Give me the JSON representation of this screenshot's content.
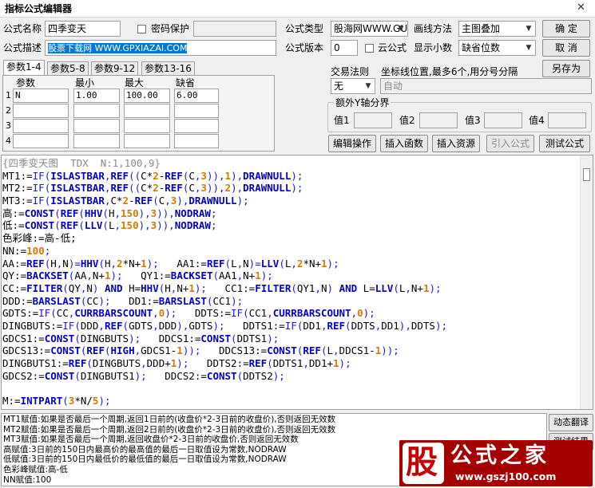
{
  "window": {
    "title": "指标公式编辑器",
    "close_glyph": "✕"
  },
  "form": {
    "name_label": "公式名称",
    "name_value": "四季变天",
    "password_label": "密码保护",
    "desc_label": "公式描述",
    "desc_value": "股票下载网 WWW.GPXIAZAI.COM",
    "type_label": "公式类型",
    "type_value": "股海网WWW.GU",
    "draw_label": "画线方法",
    "draw_value": "主图叠加",
    "version_label": "公式版本",
    "version_value": "0",
    "cloud_label": "云公式",
    "decimals_label": "显示小数",
    "decimals_value": "缺省位数",
    "trade_label": "交易法则",
    "trade_value": "无",
    "coord_label": "坐标线位置,最多6个,用分号分隔",
    "coord_value": "自动",
    "extra_axis_label": "额外Y轴分界",
    "extra_values": [
      {
        "label": "值1"
      },
      {
        "label": "值2"
      },
      {
        "label": "值3"
      },
      {
        "label": "值4"
      }
    ]
  },
  "buttons": {
    "ok": "确  定",
    "cancel": "取  消",
    "saveas": "另存为",
    "edit_ops": "编辑操作",
    "insert_fn": "插入函数",
    "insert_res": "插入资源",
    "import_formula": "引入公式",
    "test_formula": "测试公式"
  },
  "param_tabs": [
    "参数1-4",
    "参数5-8",
    "参数9-12",
    "参数13-16"
  ],
  "param_table": {
    "headers": [
      "参数",
      "最小",
      "最大",
      "缺省"
    ],
    "rows": [
      {
        "idx": "1",
        "name": "N",
        "min": "1.00",
        "max": "100.00",
        "def": "6.00"
      },
      {
        "idx": "2",
        "name": "",
        "min": "",
        "max": "",
        "def": ""
      },
      {
        "idx": "3",
        "name": "",
        "min": "",
        "max": "",
        "def": ""
      },
      {
        "idx": "4",
        "name": "",
        "min": "",
        "max": "",
        "def": ""
      }
    ]
  },
  "code_lines": [
    [
      [
        "cmt",
        "{四季变天图  TDX  N:1,100,9}"
      ]
    ],
    [
      [
        "var",
        "MT1:="
      ],
      [
        "kw",
        "IF("
      ],
      [
        "fn",
        "ISLASTBAR"
      ],
      [
        "kw",
        ","
      ],
      [
        "fn",
        "REF"
      ],
      [
        "kw",
        "(("
      ],
      [
        "var",
        "C*"
      ],
      [
        "num",
        "2"
      ],
      [
        "var",
        "-"
      ],
      [
        "fn",
        "REF"
      ],
      [
        "kw",
        "("
      ],
      [
        "var",
        "C"
      ],
      [
        "kw",
        ","
      ],
      [
        "num",
        "3"
      ],
      [
        "kw",
        "))"
      ],
      [
        "kw",
        ","
      ],
      [
        "num",
        "1"
      ],
      [
        "kw",
        "),"
      ],
      [
        "fn",
        "DRAWNULL"
      ],
      [
        "kw",
        ");"
      ]
    ],
    [
      [
        "var",
        "MT2:="
      ],
      [
        "kw",
        "IF("
      ],
      [
        "fn",
        "ISLASTBAR"
      ],
      [
        "kw",
        ","
      ],
      [
        "fn",
        "REF"
      ],
      [
        "kw",
        "(("
      ],
      [
        "var",
        "C*"
      ],
      [
        "num",
        "2"
      ],
      [
        "var",
        "-"
      ],
      [
        "fn",
        "REF"
      ],
      [
        "kw",
        "("
      ],
      [
        "var",
        "C"
      ],
      [
        "kw",
        ","
      ],
      [
        "num",
        "3"
      ],
      [
        "kw",
        "))"
      ],
      [
        "kw",
        ","
      ],
      [
        "num",
        "2"
      ],
      [
        "kw",
        "),"
      ],
      [
        "fn",
        "DRAWNULL"
      ],
      [
        "kw",
        ");"
      ]
    ],
    [
      [
        "var",
        "MT3:="
      ],
      [
        "kw",
        "IF("
      ],
      [
        "fn",
        "ISLASTBAR"
      ],
      [
        "kw",
        ","
      ],
      [
        "var",
        "C*"
      ],
      [
        "num",
        "2"
      ],
      [
        "var",
        "-"
      ],
      [
        "fn",
        "REF"
      ],
      [
        "kw",
        "("
      ],
      [
        "var",
        "C"
      ],
      [
        "kw",
        ","
      ],
      [
        "num",
        "3"
      ],
      [
        "kw",
        "),"
      ],
      [
        "fn",
        "DRAWNULL"
      ],
      [
        "kw",
        ");"
      ]
    ],
    [
      [
        "var",
        "高:="
      ],
      [
        "fn",
        "CONST"
      ],
      [
        "kw",
        "("
      ],
      [
        "fn",
        "REF"
      ],
      [
        "kw",
        "("
      ],
      [
        "fn",
        "HHV"
      ],
      [
        "kw",
        "("
      ],
      [
        "var",
        "H"
      ],
      [
        "kw",
        ","
      ],
      [
        "num",
        "150"
      ],
      [
        "kw",
        "),"
      ],
      [
        "num",
        "3"
      ],
      [
        "kw",
        "))"
      ],
      [
        "kw",
        ","
      ],
      [
        "fn",
        "NODRAW"
      ],
      [
        "kw",
        ";"
      ]
    ],
    [
      [
        "var",
        "低:="
      ],
      [
        "fn",
        "CONST"
      ],
      [
        "kw",
        "("
      ],
      [
        "fn",
        "REF"
      ],
      [
        "kw",
        "("
      ],
      [
        "fn",
        "LLV"
      ],
      [
        "kw",
        "("
      ],
      [
        "var",
        "L"
      ],
      [
        "kw",
        ","
      ],
      [
        "num",
        "150"
      ],
      [
        "kw",
        "),"
      ],
      [
        "num",
        "3"
      ],
      [
        "kw",
        "))"
      ],
      [
        "kw",
        ","
      ],
      [
        "fn",
        "NODRAW"
      ],
      [
        "kw",
        ";"
      ]
    ],
    [
      [
        "var",
        "色彩峰:=高-低;"
      ]
    ],
    [
      [
        "var",
        "NN:="
      ],
      [
        "num",
        "100"
      ],
      [
        "kw",
        ";"
      ]
    ],
    [
      [
        "var",
        "AA:="
      ],
      [
        "fn",
        "REF"
      ],
      [
        "kw",
        "("
      ],
      [
        "var",
        "H"
      ],
      [
        "kw",
        ","
      ],
      [
        "var",
        "N"
      ],
      [
        "kw",
        ")="
      ],
      [
        "fn",
        "HHV"
      ],
      [
        "kw",
        "("
      ],
      [
        "var",
        "H"
      ],
      [
        "kw",
        ","
      ],
      [
        "num",
        "2"
      ],
      [
        "var",
        "*N+"
      ],
      [
        "num",
        "1"
      ],
      [
        "kw",
        ");"
      ],
      [
        "var",
        "   AA1:="
      ],
      [
        "fn",
        "REF"
      ],
      [
        "kw",
        "("
      ],
      [
        "var",
        "L"
      ],
      [
        "kw",
        ","
      ],
      [
        "var",
        "N"
      ],
      [
        "kw",
        ")="
      ],
      [
        "fn",
        "LLV"
      ],
      [
        "kw",
        "("
      ],
      [
        "var",
        "L"
      ],
      [
        "kw",
        ","
      ],
      [
        "num",
        "2"
      ],
      [
        "var",
        "*N+"
      ],
      [
        "num",
        "1"
      ],
      [
        "kw",
        ");"
      ]
    ],
    [
      [
        "var",
        "QY:="
      ],
      [
        "fn",
        "BACKSET"
      ],
      [
        "kw",
        "("
      ],
      [
        "var",
        "AA"
      ],
      [
        "kw",
        ","
      ],
      [
        "var",
        "N+"
      ],
      [
        "num",
        "1"
      ],
      [
        "kw",
        ");"
      ],
      [
        "var",
        "   QY1:="
      ],
      [
        "fn",
        "BACKSET"
      ],
      [
        "kw",
        "("
      ],
      [
        "var",
        "AA1"
      ],
      [
        "kw",
        ","
      ],
      [
        "var",
        "N+"
      ],
      [
        "num",
        "1"
      ],
      [
        "kw",
        ");"
      ]
    ],
    [
      [
        "var",
        "CC:="
      ],
      [
        "fn",
        "FILTER"
      ],
      [
        "kw",
        "("
      ],
      [
        "var",
        "QY"
      ],
      [
        "kw",
        ","
      ],
      [
        "var",
        "N"
      ],
      [
        "kw",
        ") "
      ],
      [
        "fn",
        "AND"
      ],
      [
        "var",
        " H="
      ],
      [
        "fn",
        "HHV"
      ],
      [
        "kw",
        "("
      ],
      [
        "var",
        "H"
      ],
      [
        "kw",
        ","
      ],
      [
        "var",
        "N+"
      ],
      [
        "num",
        "1"
      ],
      [
        "kw",
        ");"
      ],
      [
        "var",
        "   CC1:="
      ],
      [
        "fn",
        "FILTER"
      ],
      [
        "kw",
        "("
      ],
      [
        "var",
        "QY1"
      ],
      [
        "kw",
        ","
      ],
      [
        "var",
        "N"
      ],
      [
        "kw",
        ") "
      ],
      [
        "fn",
        "AND"
      ],
      [
        "var",
        " L="
      ],
      [
        "fn",
        "LLV"
      ],
      [
        "kw",
        "("
      ],
      [
        "var",
        "L"
      ],
      [
        "kw",
        ","
      ],
      [
        "var",
        "N+"
      ],
      [
        "num",
        "1"
      ],
      [
        "kw",
        ");"
      ]
    ],
    [
      [
        "var",
        "DDD:="
      ],
      [
        "fn",
        "BARSLAST"
      ],
      [
        "kw",
        "("
      ],
      [
        "var",
        "CC"
      ],
      [
        "kw",
        ");"
      ],
      [
        "var",
        "   DD1:="
      ],
      [
        "fn",
        "BARSLAST"
      ],
      [
        "kw",
        "("
      ],
      [
        "var",
        "CC1"
      ],
      [
        "kw",
        ");"
      ]
    ],
    [
      [
        "var",
        "GDTS:="
      ],
      [
        "kw",
        "IF("
      ],
      [
        "var",
        "CC"
      ],
      [
        "kw",
        ","
      ],
      [
        "fn",
        "CURRBARSCOUNT"
      ],
      [
        "kw",
        ","
      ],
      [
        "num",
        "0"
      ],
      [
        "kw",
        ");"
      ],
      [
        "var",
        "   DDTS:="
      ],
      [
        "kw",
        "IF("
      ],
      [
        "var",
        "CC1"
      ],
      [
        "kw",
        ","
      ],
      [
        "fn",
        "CURRBARSCOUNT"
      ],
      [
        "kw",
        ","
      ],
      [
        "num",
        "0"
      ],
      [
        "kw",
        ");"
      ]
    ],
    [
      [
        "var",
        "DINGBUTS:="
      ],
      [
        "kw",
        "IF("
      ],
      [
        "var",
        "DDD"
      ],
      [
        "kw",
        ","
      ],
      [
        "fn",
        "REF"
      ],
      [
        "kw",
        "("
      ],
      [
        "var",
        "GDTS"
      ],
      [
        "kw",
        ","
      ],
      [
        "var",
        "DDD"
      ],
      [
        "kw",
        "),"
      ],
      [
        "var",
        "GDTS"
      ],
      [
        "kw",
        ");"
      ],
      [
        "var",
        "   DDTS1:="
      ],
      [
        "kw",
        "IF("
      ],
      [
        "var",
        "DD1"
      ],
      [
        "kw",
        ","
      ],
      [
        "fn",
        "REF"
      ],
      [
        "kw",
        "("
      ],
      [
        "var",
        "DDTS"
      ],
      [
        "kw",
        ","
      ],
      [
        "var",
        "DD1"
      ],
      [
        "kw",
        "),"
      ],
      [
        "var",
        "DDTS"
      ],
      [
        "kw",
        ");"
      ]
    ],
    [
      [
        "var",
        "GDCS1:="
      ],
      [
        "fn",
        "CONST"
      ],
      [
        "kw",
        "("
      ],
      [
        "var",
        "DINGBUTS"
      ],
      [
        "kw",
        ");"
      ],
      [
        "var",
        "   DDCS1:="
      ],
      [
        "fn",
        "CONST"
      ],
      [
        "kw",
        "("
      ],
      [
        "var",
        "DDTS1"
      ],
      [
        "kw",
        ");"
      ]
    ],
    [
      [
        "var",
        "GDCS13:="
      ],
      [
        "fn",
        "CONST"
      ],
      [
        "kw",
        "("
      ],
      [
        "fn",
        "REF"
      ],
      [
        "kw",
        "("
      ],
      [
        "fn",
        "HIGH"
      ],
      [
        "kw",
        ","
      ],
      [
        "var",
        "GDCS1-"
      ],
      [
        "num",
        "1"
      ],
      [
        "kw",
        "));"
      ],
      [
        "var",
        "   DDCS13:="
      ],
      [
        "fn",
        "CONST"
      ],
      [
        "kw",
        "("
      ],
      [
        "fn",
        "REF"
      ],
      [
        "kw",
        "("
      ],
      [
        "var",
        "L"
      ],
      [
        "kw",
        ","
      ],
      [
        "var",
        "DDCS1-"
      ],
      [
        "num",
        "1"
      ],
      [
        "kw",
        "));"
      ]
    ],
    [
      [
        "var",
        "DINGBUTS1:="
      ],
      [
        "fn",
        "REF"
      ],
      [
        "kw",
        "("
      ],
      [
        "var",
        "DINGBUTS"
      ],
      [
        "kw",
        ","
      ],
      [
        "var",
        "DDD+"
      ],
      [
        "num",
        "1"
      ],
      [
        "kw",
        ");"
      ],
      [
        "var",
        "   DDTS2:="
      ],
      [
        "fn",
        "REF"
      ],
      [
        "kw",
        "("
      ],
      [
        "var",
        "DDTS1"
      ],
      [
        "kw",
        ","
      ],
      [
        "var",
        "DD1+"
      ],
      [
        "num",
        "1"
      ],
      [
        "kw",
        ");"
      ]
    ],
    [
      [
        "var",
        "GDCS2:="
      ],
      [
        "fn",
        "CONST"
      ],
      [
        "kw",
        "("
      ],
      [
        "var",
        "DINGBUTS1"
      ],
      [
        "kw",
        ");"
      ],
      [
        "var",
        "   DDCS2:="
      ],
      [
        "fn",
        "CONST"
      ],
      [
        "kw",
        "("
      ],
      [
        "var",
        "DDTS2"
      ],
      [
        "kw",
        ");"
      ]
    ],
    [
      [
        "var",
        ""
      ]
    ],
    [
      [
        "var",
        "M:="
      ],
      [
        "fn",
        "INTPART"
      ],
      [
        "kw",
        "("
      ],
      [
        "num",
        "3"
      ],
      [
        "var",
        "*N/"
      ],
      [
        "num",
        "5"
      ],
      [
        "kw",
        ");"
      ]
    ]
  ],
  "output_lines": [
    "MT1赋值:如果是否最后一个周期,返回1日前的(收盘价*2-3日前的收盘价),否则返回无效数",
    "MT2赋值:如果是否最后一个周期,返回2日前的(收盘价*2-3日前的收盘价),否则返回无效数",
    "MT3赋值:如果是否最后一个周期,返回收盘价*2-3日前的收盘价,否则返回无效数",
    "高赋值:3日前的150日内最高价的最高值的最后一日取值设为常数,NODRAW",
    "低赋值:3日前的150日内最低价的最低值的最后一日取值设为常数,NODRAW",
    "色彩峰赋值:高-低",
    "NN赋值:100"
  ],
  "side_buttons": {
    "dynamic": "动态翻译",
    "test_result": "测试结果"
  },
  "logo": {
    "mark": "股",
    "text": "公式之家",
    "url": "www.gszj100.com"
  }
}
